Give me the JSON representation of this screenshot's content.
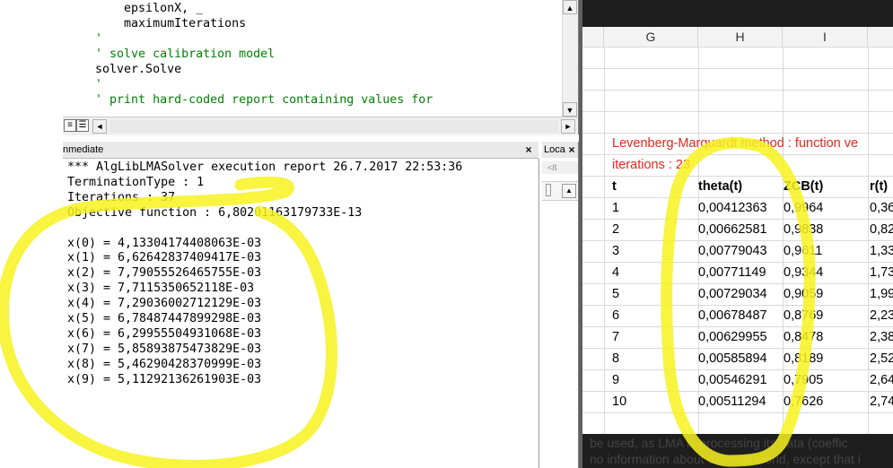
{
  "code_editor": {
    "lines": [
      {
        "text": "        epsilonX, _",
        "kind": "code"
      },
      {
        "text": "        maximumIterations",
        "kind": "code"
      },
      {
        "text": "    '",
        "kind": "comment"
      },
      {
        "text": "    ' solve calibration model",
        "kind": "comment"
      },
      {
        "text": "    solver.Solve",
        "kind": "code"
      },
      {
        "text": "    '",
        "kind": "comment"
      },
      {
        "text": "    ' print hard-coded report containing values for",
        "kind": "comment"
      }
    ],
    "scroll_up": "▲",
    "scroll_down": "▼",
    "scroll_left": "◄",
    "scroll_right": "►",
    "view_procedure_icon": "≡",
    "view_module_icon": "☰"
  },
  "immediate_window": {
    "title": "nmediate",
    "close": "×",
    "lines": [
      "*** AlgLibLMASolver execution report 26.7.2017 22:53:36",
      "TerminationType : 1",
      "Iterations : 37",
      "Objective function : 6,80201163179733E-13",
      "",
      "x(0) = 4,13304174408063E-03",
      "x(1) = 6,62642837409417E-03",
      "x(2) = 7,79055526465755E-03",
      "x(3) = 7,7115350652118E-03",
      "x(4) = 7,29036002712129E-03",
      "x(5) = 6,78487447899298E-03",
      "x(6) = 6,29955504931068E-03",
      "x(7) = 5,85893875473829E-03",
      "x(8) = 5,46290428370999E-03",
      "x(9) = 5,11292136261903E-03"
    ]
  },
  "locals_window": {
    "title": "Loca",
    "close": "×",
    "bar_text": "<ß",
    "expand_btn": "▲"
  },
  "excel": {
    "columns": [
      "G",
      "H",
      "I",
      ""
    ],
    "red_line_1": "Levenberg-Marquardt method : function ve",
    "red_line_2_label": "iterations : ",
    "red_line_2_value": "23",
    "headers": [
      "t",
      "theta(t)",
      "ZCB(t)",
      "r(t)"
    ],
    "rows": [
      [
        "1",
        "0,00412363",
        "0,9964",
        "0,36"
      ],
      [
        "2",
        "0,00662581",
        "0,9838",
        "0,82"
      ],
      [
        "3",
        "0,00779043",
        "0,9611",
        "1,33"
      ],
      [
        "4",
        "0,00771149",
        "0,9344",
        "1,73"
      ],
      [
        "5",
        "0,00729034",
        "0,9059",
        "1,99"
      ],
      [
        "6",
        "0,00678487",
        "0,8769",
        "2,23"
      ],
      [
        "7",
        "0,00629955",
        "0,8478",
        "2,38"
      ],
      [
        "8",
        "0,00585894",
        "0,8189",
        "2,52"
      ],
      [
        "9",
        "0,00546291",
        "0,7905",
        "2,64"
      ],
      [
        "10",
        "0,00511294",
        "0,7626",
        "2,74"
      ]
    ],
    "background_text_1": "be used, as LMA is processing its data (coeffic",
    "background_text_2": "no information about external world, except that i"
  },
  "colors": {
    "highlight": "#f7f21e",
    "comment": "#008000",
    "excel_red": "#e8261f"
  }
}
